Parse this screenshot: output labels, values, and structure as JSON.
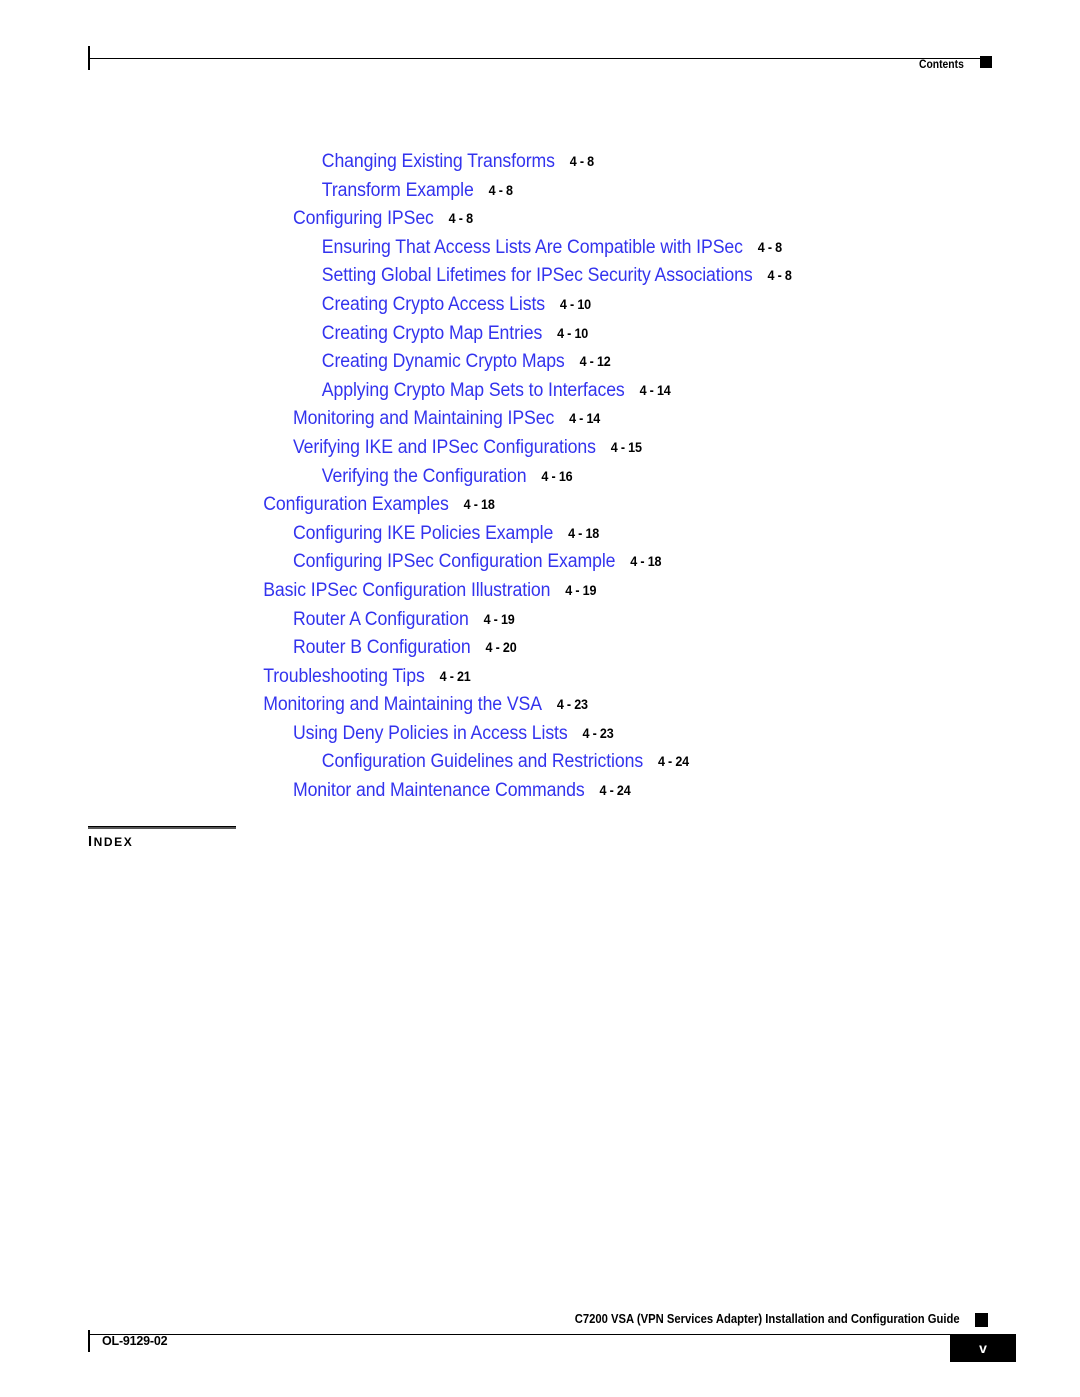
{
  "header": {
    "label": "Contents",
    "marker_icon": "black-square-icon"
  },
  "toc": {
    "entries": [
      {
        "level": 3,
        "title": "Changing Existing Transforms",
        "page": "4 - 8"
      },
      {
        "level": 3,
        "title": "Transform Example",
        "page": "4 - 8"
      },
      {
        "level": 2,
        "title": "Configuring IPSec",
        "page": "4 - 8"
      },
      {
        "level": 3,
        "title": "Ensuring That Access Lists Are Compatible with IPSec",
        "page": "4 - 8"
      },
      {
        "level": 3,
        "title": "Setting Global Lifetimes for IPSec Security Associations",
        "page": "4 - 8"
      },
      {
        "level": 3,
        "title": "Creating Crypto Access Lists",
        "page": "4 - 10"
      },
      {
        "level": 3,
        "title": "Creating Crypto Map Entries",
        "page": "4 - 10"
      },
      {
        "level": 3,
        "title": "Creating Dynamic Crypto Maps",
        "page": "4 - 12"
      },
      {
        "level": 3,
        "title": "Applying Crypto Map Sets to Interfaces",
        "page": "4 - 14"
      },
      {
        "level": 2,
        "title": "Monitoring and Maintaining IPSec",
        "page": "4 - 14"
      },
      {
        "level": 2,
        "title": "Verifying IKE and IPSec Configurations",
        "page": "4 - 15"
      },
      {
        "level": 3,
        "title": "Verifying the Configuration",
        "page": "4 - 16"
      },
      {
        "level": 1,
        "title": "Configuration Examples",
        "page": "4 - 18"
      },
      {
        "level": 2,
        "title": "Configuring IKE Policies Example",
        "page": "4 - 18"
      },
      {
        "level": 2,
        "title": "Configuring IPSec Configuration Example",
        "page": "4 - 18"
      },
      {
        "level": 1,
        "title": "Basic IPSec Configuration Illustration",
        "page": "4 - 19"
      },
      {
        "level": 2,
        "title": "Router A Configuration",
        "page": "4 - 19"
      },
      {
        "level": 2,
        "title": "Router B Configuration",
        "page": "4 - 20"
      },
      {
        "level": 1,
        "title": "Troubleshooting Tips",
        "page": "4 - 21"
      },
      {
        "level": 1,
        "title": "Monitoring and Maintaining the VSA",
        "page": "4 - 23"
      },
      {
        "level": 2,
        "title": "Using Deny Policies in Access Lists",
        "page": "4 - 23"
      },
      {
        "level": 3,
        "title": "Configuration Guidelines and Restrictions",
        "page": "4 - 24"
      },
      {
        "level": 2,
        "title": "Monitor and Maintenance Commands",
        "page": "4 - 24"
      }
    ]
  },
  "index_section": {
    "label_first_letter": "I",
    "label_rest": "NDEX"
  },
  "footer": {
    "guide_title": "C7200 VSA (VPN Services Adapter) Installation and Configuration Guide",
    "doc_id": "OL-9129-02",
    "page_number": "v",
    "marker_icon": "black-square-icon"
  },
  "colors": {
    "link_blue": "#3333EE",
    "text_black": "#000000",
    "page_background": "#FFFFFF"
  }
}
